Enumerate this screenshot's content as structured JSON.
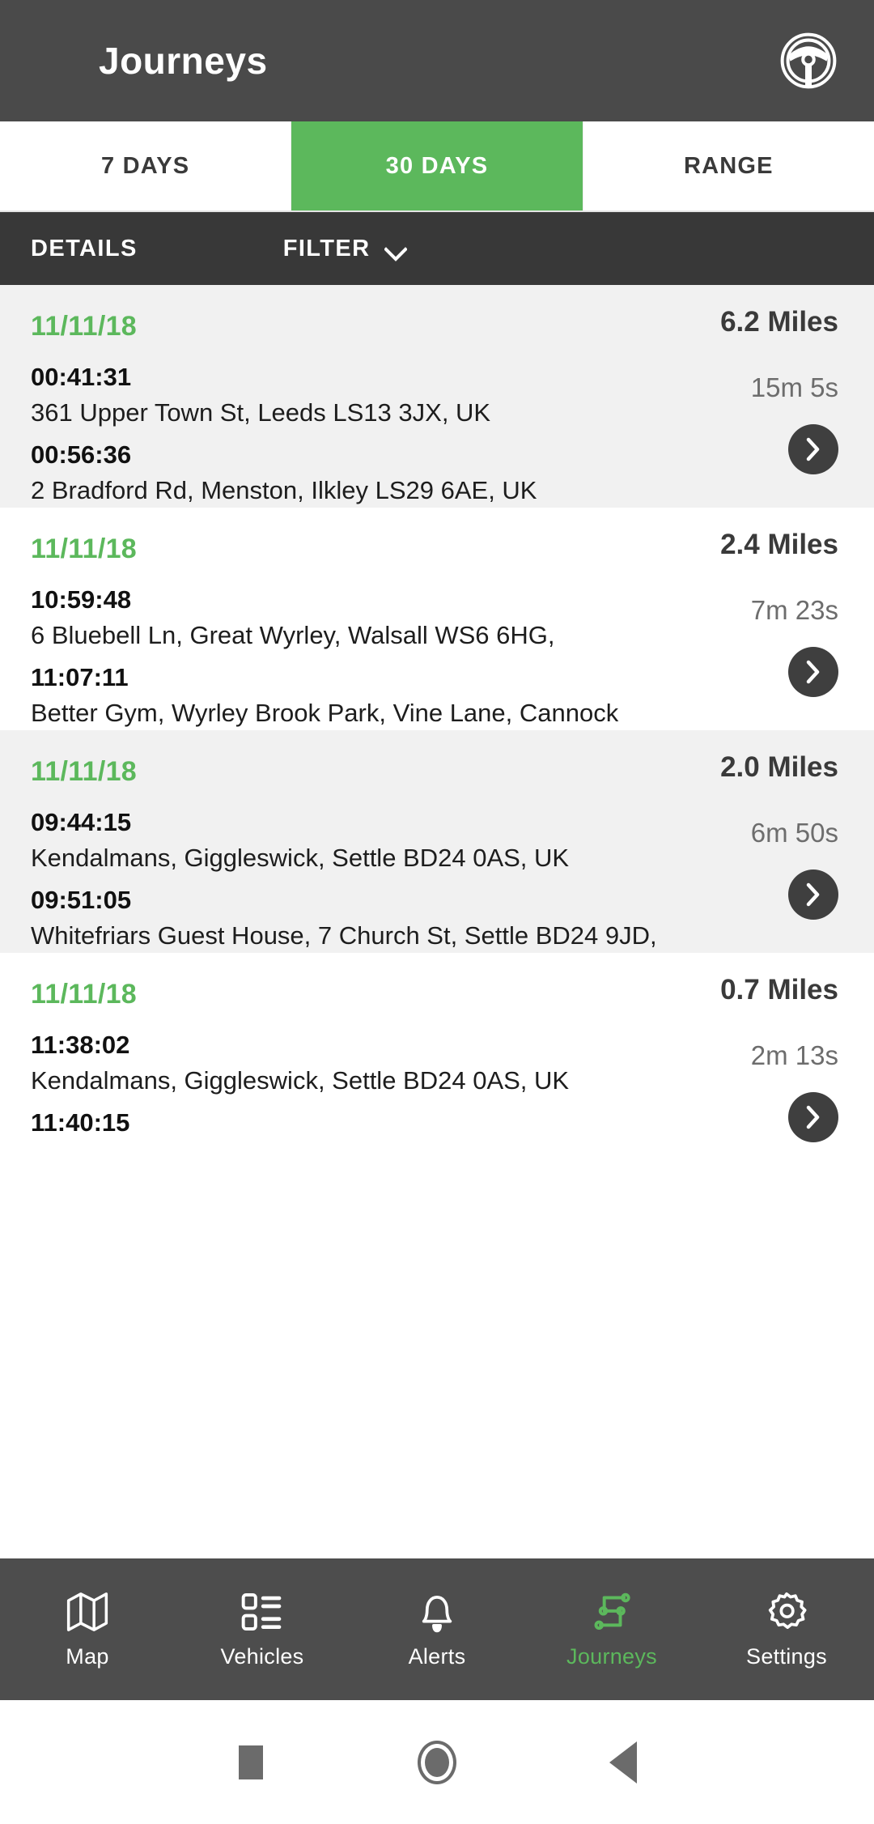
{
  "header": {
    "title": "Journeys",
    "icon": "steering-wheel-icon"
  },
  "segments": [
    {
      "label": "7 DAYS",
      "active": false
    },
    {
      "label": "30 DAYS",
      "active": true
    },
    {
      "label": "RANGE",
      "active": false
    }
  ],
  "filterbar": {
    "details_label": "DETAILS",
    "filter_label": "FILTER",
    "filter_chevron": "chevron-down-icon"
  },
  "colors": {
    "accent_green": "#5cb85c",
    "appbar_dark": "#4a4a4a",
    "filterbar_dark": "#383838",
    "bottomnav_dark": "#4d4d4d",
    "row_alt": "#f1f1f1",
    "row_base": "#ffffff"
  },
  "journeys": [
    {
      "date": "11/11/18",
      "miles": "6.2 Miles",
      "duration": "15m 5s",
      "start_time": "00:41:31",
      "start_address": "361 Upper Town St, Leeds LS13 3JX, UK",
      "end_time": "00:56:36",
      "end_address": "2 Bradford Rd, Menston, Ilkley LS29 6AE, UK"
    },
    {
      "date": "11/11/18",
      "miles": "2.4 Miles",
      "duration": "7m 23s",
      "start_time": "10:59:48",
      "start_address": "6 Bluebell Ln, Great Wyrley, Walsall WS6 6HG,",
      "end_time": "11:07:11",
      "end_address": "Better Gym, Wyrley Brook Park, Vine Lane, Cannock"
    },
    {
      "date": "11/11/18",
      "miles": "2.0 Miles",
      "duration": "6m 50s",
      "start_time": "09:44:15",
      "start_address": "Kendalmans, Giggleswick, Settle BD24 0AS, UK",
      "end_time": "09:51:05",
      "end_address": "Whitefriars Guest House, 7 Church St, Settle BD24 9JD,"
    },
    {
      "date": "11/11/18",
      "miles": "0.7 Miles",
      "duration": "2m 13s",
      "start_time": "11:38:02",
      "start_address": "Kendalmans, Giggleswick, Settle BD24 0AS, UK",
      "end_time": "11:40:15",
      "end_address": ""
    }
  ],
  "bottom_nav": [
    {
      "label": "Map",
      "icon": "map-icon",
      "active": false
    },
    {
      "label": "Vehicles",
      "icon": "list-icon",
      "active": false
    },
    {
      "label": "Alerts",
      "icon": "bell-icon",
      "active": false
    },
    {
      "label": "Journeys",
      "icon": "route-icon",
      "active": true
    },
    {
      "label": "Settings",
      "icon": "gear-icon",
      "active": false
    }
  ],
  "system_nav": [
    {
      "icon": "recents-square-icon"
    },
    {
      "icon": "home-circle-icon"
    },
    {
      "icon": "back-triangle-icon"
    }
  ]
}
